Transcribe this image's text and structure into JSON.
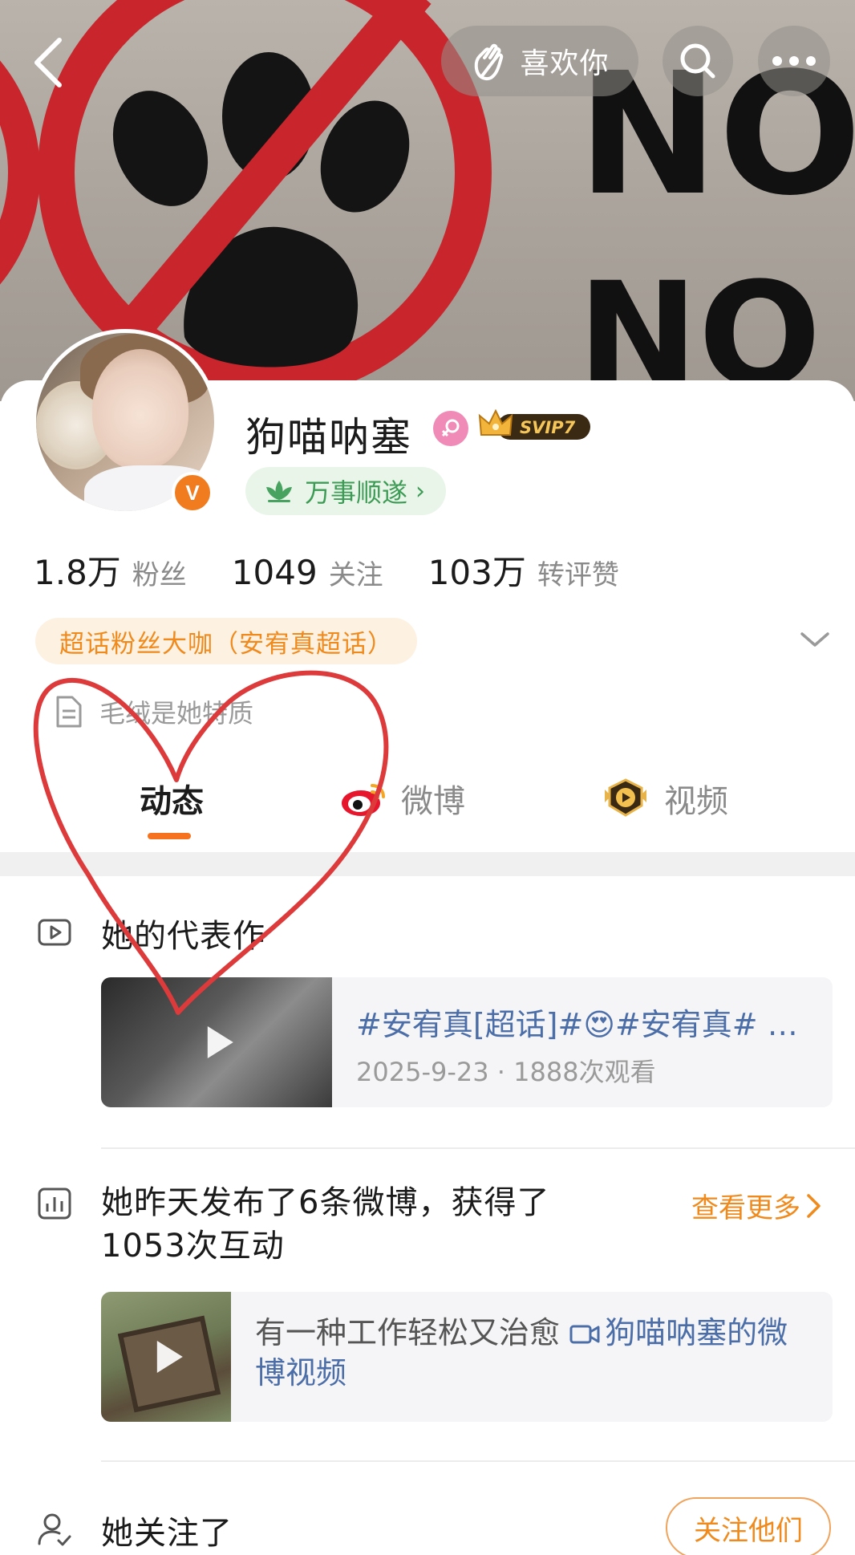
{
  "header": {
    "like_label": "喜欢你",
    "cover_text_1": "NO",
    "cover_text_2": "NO"
  },
  "profile": {
    "name": "狗喵呐塞",
    "svip_badge": "SVIP7",
    "verified_badge": "V",
    "blessing": "万事顺遂",
    "stats": [
      {
        "num": "1.8万",
        "label": "粉丝"
      },
      {
        "num": "1049",
        "label": "关注"
      },
      {
        "num": "103万",
        "label": "转评赞"
      }
    ],
    "superfan": "超话粉丝大咖（安宥真超话）",
    "bio": "毛绒是她特质"
  },
  "tabs": [
    {
      "label": "动态",
      "active": true
    },
    {
      "label": "微博",
      "active": false
    },
    {
      "label": "视频",
      "active": false
    }
  ],
  "representative": {
    "title": "她的代表作",
    "video_title": "#安宥真[超话]#😍#安宥真# …",
    "video_meta": "2025-9-23 · 1888次观看"
  },
  "activity": {
    "title": "她昨天发布了6条微博，获得了1053次互动",
    "see_more": "查看更多",
    "post_text": "有一种工作轻松又治愈 ",
    "post_link": "狗喵呐塞的微博视频"
  },
  "following": {
    "title": "她关注了",
    "button": "关注他们"
  },
  "colors": {
    "accent": "#f7721e",
    "link": "#4b6ea8",
    "orange_text": "#f08a1c",
    "doodle": "#dd3b3b"
  }
}
